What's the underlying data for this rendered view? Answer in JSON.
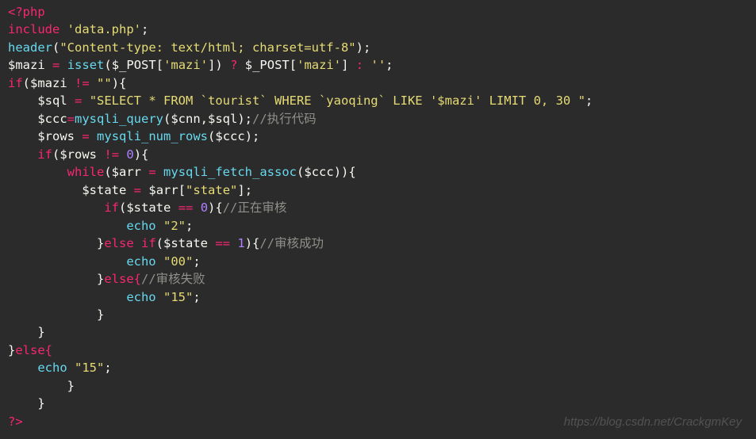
{
  "code": {
    "l1": {
      "open": "<?php"
    },
    "l2": {
      "kw": "include",
      "sp": " ",
      "str": "'data.php'",
      "end": ";"
    },
    "l3": {
      "fn": "header",
      "open": "(",
      "str": "\"Content-type: text/html; charset=utf-8\"",
      "close": ")",
      "end": ";"
    },
    "l4": {
      "var": "$mazi",
      "sp": " ",
      "op": "=",
      "sp2": " ",
      "fn": "isset",
      "open": "(",
      "var2": "$_POST",
      "brk": "[",
      "str": "'mazi'",
      "brk2": "]",
      "close": ") ",
      "q": "?",
      "sp3": " ",
      "var3": "$_POST",
      "brk3": "[",
      "str2": "'mazi'",
      "brk4": "]",
      "sp4": " ",
      "colon": ":",
      "sp5": " ",
      "str3": "''",
      "end": ";"
    },
    "l5": {
      "kw": "if",
      "open": "(",
      "var": "$mazi",
      "sp": " ",
      "op": "!=",
      "sp2": " ",
      "str": "\"\"",
      "close": "){"
    },
    "l6": {
      "pad": "    ",
      "var": "$sql",
      "sp": " ",
      "op": "=",
      "sp2": " ",
      "str": "\"SELECT * FROM `tourist` WHERE `yaoqing` LIKE '$mazi' LIMIT 0, 30 \"",
      "end": ";"
    },
    "l7": {
      "pad": "    ",
      "var": "$ccc",
      "op": "=",
      "fn": "mysqli_query",
      "open": "(",
      "var2": "$cnn",
      "comma": ",",
      "var3": "$sql",
      "close": ")",
      "end": ";",
      "cmt": "//执行代码"
    },
    "l8": {
      "pad": "    ",
      "var": "$rows",
      "sp": " ",
      "op": "=",
      "sp2": " ",
      "fn": "mysqli_num_rows",
      "open": "(",
      "var2": "$ccc",
      "close": ")",
      "end": ";"
    },
    "l9": {
      "pad": "    ",
      "kw": "if",
      "open": "(",
      "var": "$rows",
      "sp": " ",
      "op": "!=",
      "sp2": " ",
      "num": "0",
      "close": "){"
    },
    "l10": {
      "pad": "        ",
      "kw": "while",
      "open": "(",
      "var": "$arr",
      "sp": " ",
      "op": "=",
      "sp2": " ",
      "fn": "mysqli_fetch_assoc",
      "open2": "(",
      "var2": "$ccc",
      "close2": ")",
      "close": "){"
    },
    "l11": {
      "pad": "          ",
      "var": "$state",
      "sp": " ",
      "op": "=",
      "sp2": " ",
      "var2": "$arr",
      "brk": "[",
      "str": "\"state\"",
      "brk2": "]",
      "end": ";"
    },
    "l12": {
      "pad": "             ",
      "kw": "if",
      "open": "(",
      "var": "$state",
      "sp": " ",
      "op": "==",
      "sp2": " ",
      "num": "0",
      "close": "){",
      "cmt": "//正在审核"
    },
    "l13": {
      "pad": "                ",
      "kw": "echo",
      "sp": " ",
      "str": "\"2\"",
      "end": ";"
    },
    "l14": {
      "pad": "            }",
      "kw": "else if",
      "open": "(",
      "var": "$state",
      "sp": " ",
      "op": "==",
      "sp2": " ",
      "num": "1",
      "close": "){",
      "cmt": "//审核成功"
    },
    "l15": {
      "pad": "                ",
      "kw": "echo",
      "sp": " ",
      "str": "\"00\"",
      "end": ";"
    },
    "l16": {
      "pad": "            }",
      "kw": "else{",
      "cmt": "//审核失败"
    },
    "l17": {
      "pad": "                ",
      "kw": "echo",
      "sp": " ",
      "str": "\"15\"",
      "end": ";"
    },
    "l18": {
      "pad": "            }"
    },
    "l19": {
      "pad": "    }"
    },
    "l20": {
      "txt": "}",
      "kw": "else{"
    },
    "l21": {
      "pad": "    ",
      "kw": "echo",
      "sp": " ",
      "str": "\"15\"",
      "end": ";"
    },
    "l22": {
      "pad": "        }"
    },
    "l23": {
      "pad": "    }"
    },
    "l24": {
      "txt": "?>"
    }
  },
  "watermark": "https://blog.csdn.net/CrackgmKey"
}
